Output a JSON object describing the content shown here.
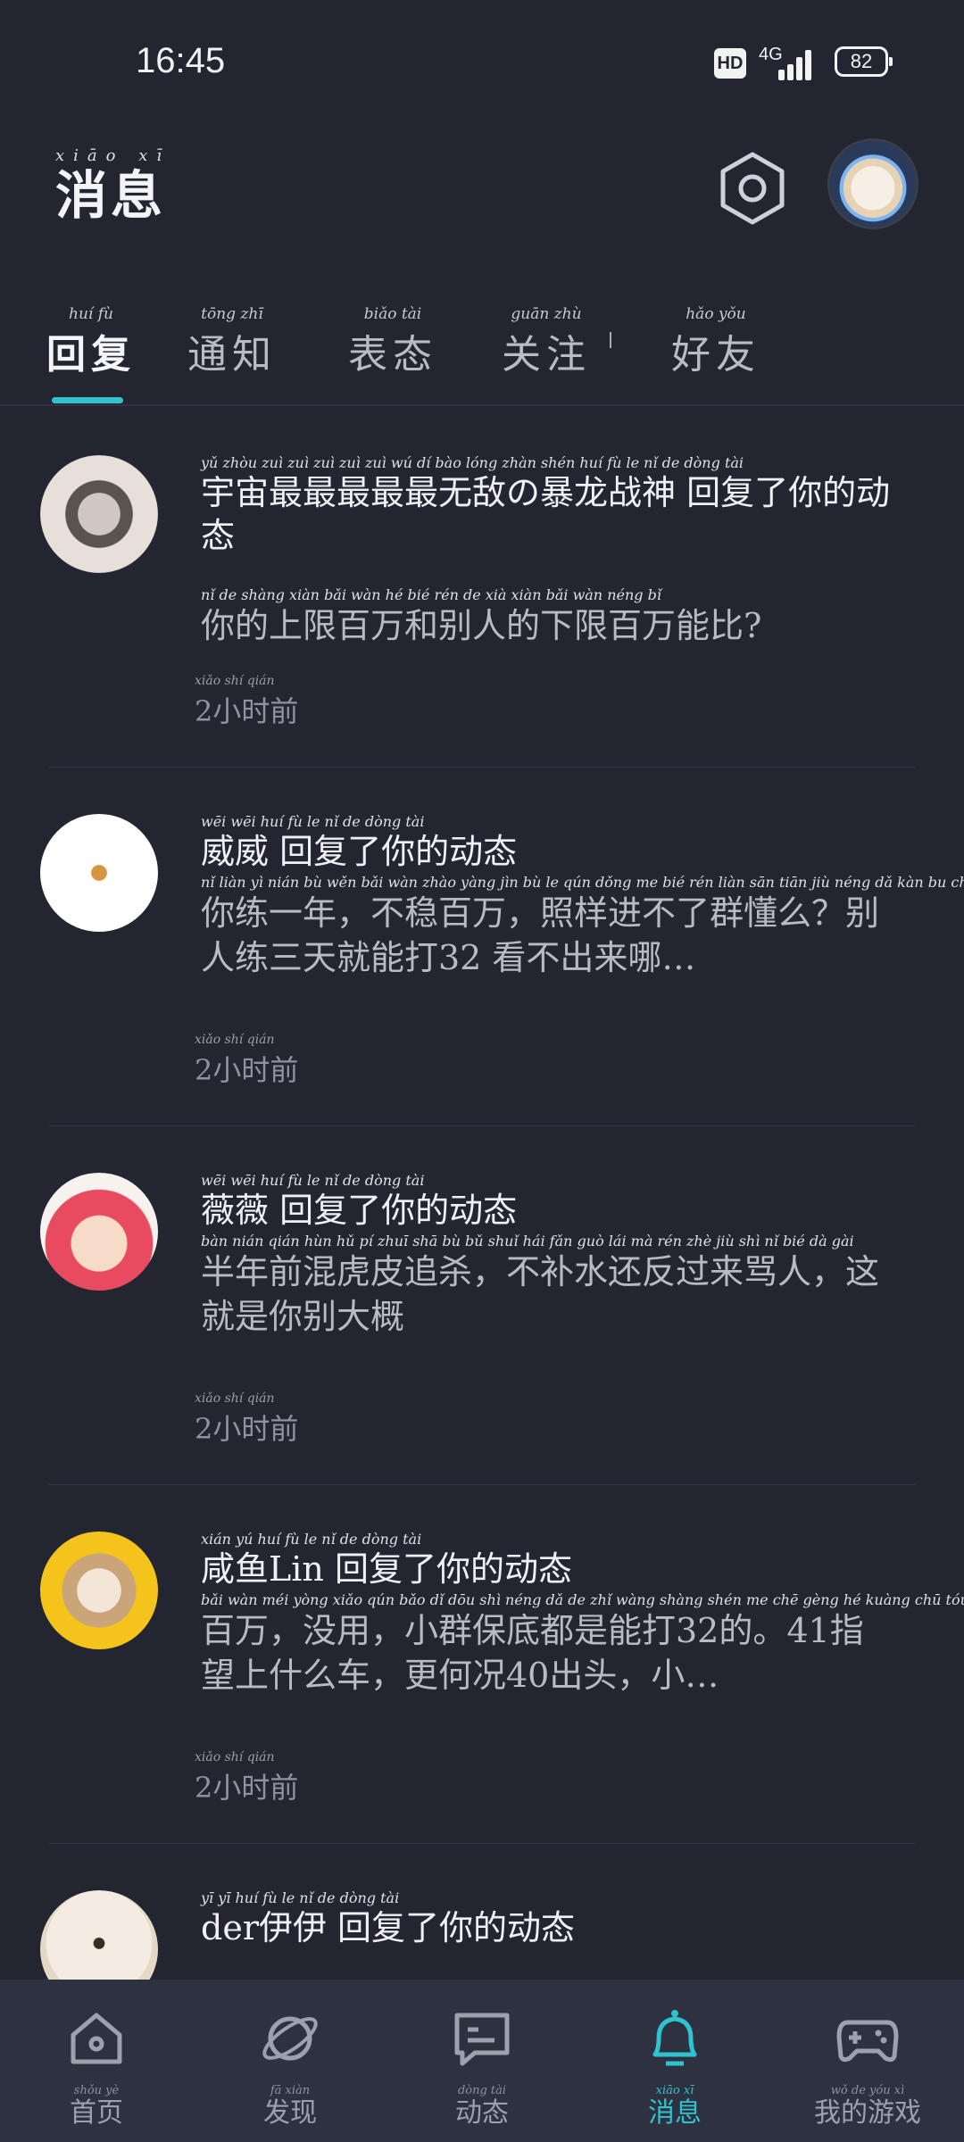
{
  "status": {
    "time": "16:45",
    "hd": "HD",
    "network": "4G",
    "battery": "82"
  },
  "header": {
    "title": "消息",
    "title_pinyin": "xiāo xī"
  },
  "tabs": [
    {
      "label": "回复",
      "pinyin": "huí fù"
    },
    {
      "label": "通知",
      "pinyin": "tōng zhī"
    },
    {
      "label": "表态",
      "pinyin": "biǎo tài"
    },
    {
      "label": "关注",
      "pinyin": "guān zhù"
    },
    {
      "label": "好友",
      "pinyin": "hǎo yǒu"
    }
  ],
  "messages": [
    {
      "header": "宇宙最最最最最无敌の暴龙战神 回复了你的动态",
      "header_pinyin": "yǔ zhòu zuì zuì zuì zuì zuì wú dí bào lóng zhàn shén huí fù le nǐ de dòng tài",
      "body": "你的上限百万和别人的下限百万能比?",
      "body_pinyin": "nǐ de shàng xiàn bǎi wàn hé bié rén de xià xiàn bǎi wàn néng bǐ",
      "time": "2小时前",
      "time_pinyin": "xiǎo shí qián"
    },
    {
      "header": "威威 回复了你的动态",
      "header_pinyin": "wēi wēi huí fù le nǐ de dòng tài",
      "body": "你练一年，不稳百万，照样进不了群懂么？别人练三天就能打32 看不出来哪…",
      "body_pinyin": "nǐ liàn yì nián bù wěn bǎi wàn zhào yàng jìn bù le qún dǒng me bié rén liàn sān tiān jiù néng dǎ kàn bu chū lái nǎ",
      "time": "2小时前",
      "time_pinyin": "xiǎo shí qián"
    },
    {
      "header": "薇薇 回复了你的动态",
      "header_pinyin": "wēi wēi huí fù le nǐ de dòng tài",
      "body": "半年前混虎皮追杀，不补水还反过来骂人，这就是你别大概",
      "body_pinyin": "bàn nián qián hùn hǔ pí zhuī shā bù bǔ shuǐ hái fǎn guò lái mà rén zhè jiù shì nǐ bié dà gài",
      "time": "2小时前",
      "time_pinyin": "xiǎo shí qián"
    },
    {
      "header": "咸鱼Lin 回复了你的动态",
      "header_pinyin": "xián yú huí fù le nǐ de dòng tài",
      "body": "百万，没用，小群保底都是能打32的。41指望上什么车，更何况40出头，小…",
      "body_pinyin": "bǎi wàn méi yòng xiǎo qún bǎo dǐ dōu shì néng dǎ de zhǐ wàng shàng shén me chē gèng hé kuàng chū tóu xiǎo",
      "time": "2小时前",
      "time_pinyin": "xiǎo shí qián"
    },
    {
      "header": "der伊伊 回复了你的动态",
      "header_pinyin": "yī yī huí fù le nǐ de dòng tài",
      "body": "",
      "body_pinyin": "",
      "time": "",
      "time_pinyin": ""
    }
  ],
  "nav": [
    {
      "label": "首页",
      "pinyin": "shǒu yè",
      "icon": "home-icon"
    },
    {
      "label": "发现",
      "pinyin": "fā xiàn",
      "icon": "planet-icon"
    },
    {
      "label": "动态",
      "pinyin": "dòng tài",
      "icon": "chat-icon"
    },
    {
      "label": "消息",
      "pinyin": "xiāo xī",
      "icon": "bell-icon"
    },
    {
      "label": "我的游戏",
      "pinyin": "wǒ de yóu xì",
      "icon": "gamepad-icon"
    }
  ],
  "colors": {
    "background": "#232631",
    "accent": "#2ec3cf",
    "nav_background": "#2e3240"
  }
}
